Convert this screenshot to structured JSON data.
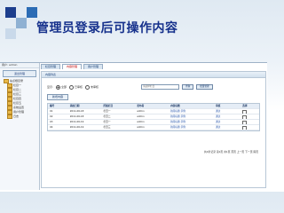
{
  "colors": {
    "headline": "#16318c",
    "logo": [
      "#1c3e8d",
      "#8fb1d3",
      "#2b6cb5",
      "#c9d9ea"
    ]
  },
  "headline": "管理员登录后可操作内容",
  "sidebar": {
    "user_text": "用户: admin",
    "button_label": "退出管理",
    "tree": [
      "站点根目录",
      "栏目一",
      "栏目二",
      "栏目三",
      "栏目四",
      "栏目五",
      "系统设置",
      "用户管理",
      "日志"
    ]
  },
  "tabs": [
    {
      "label": "栏目管理",
      "active": false
    },
    {
      "label": "内容管理",
      "active": true
    },
    {
      "label": "用户管理",
      "active": false
    }
  ],
  "panel": {
    "title": "内容列表",
    "filter": {
      "label": "显示:",
      "radio_options": [
        "全部",
        "已审核",
        "未审核"
      ],
      "select_value": "请选择栏目",
      "query_button": "查询",
      "manage_button": "批量管理"
    },
    "save_button": "新增内容",
    "table": {
      "headers": [
        "编号",
        "添加日期",
        "所属栏目",
        "发布者",
        "内容标题",
        "审核",
        "选择"
      ],
      "rows": [
        [
          "01",
          "2011-06-18",
          "栏目一",
          "admin",
          "新闻标题 示例",
          "通过",
          ""
        ],
        [
          "02",
          "2011-06-18",
          "栏目二",
          "admin",
          "新闻标题 示例",
          "通过",
          ""
        ],
        [
          "03",
          "2011-06-19",
          "栏目一",
          "admin",
          "新闻标题 示例",
          "通过",
          ""
        ],
        [
          "04",
          "2011-06-19",
          "栏目三",
          "admin",
          "新闻标题 示例",
          "通过",
          ""
        ]
      ]
    },
    "footer": "共4条记录 第1页 共1页 首页 上一页 下一页 尾页"
  }
}
